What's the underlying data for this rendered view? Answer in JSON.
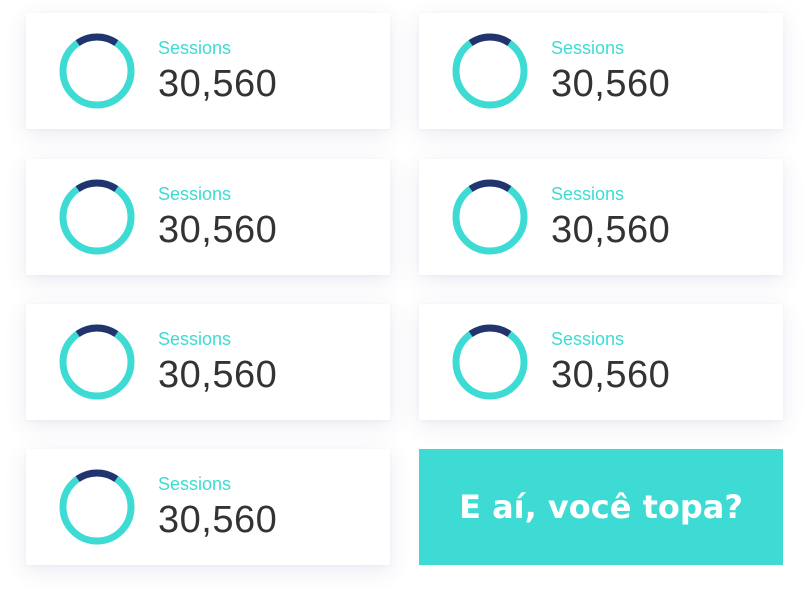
{
  "cards": [
    {
      "label": "Sessions",
      "value": "30,560"
    },
    {
      "label": "Sessions",
      "value": "30,560"
    },
    {
      "label": "Sessions",
      "value": "30,560"
    },
    {
      "label": "Sessions",
      "value": "30,560"
    },
    {
      "label": "Sessions",
      "value": "30,560"
    },
    {
      "label": "Sessions",
      "value": "30,560"
    },
    {
      "label": "Sessions",
      "value": "30,560"
    }
  ],
  "ring": {
    "track_color": "#3ddbd3",
    "highlight_color": "#23336e",
    "highlight_fraction": 0.14
  },
  "cta": {
    "label": "E aí, você topa?",
    "color": "#3ddbd3"
  }
}
